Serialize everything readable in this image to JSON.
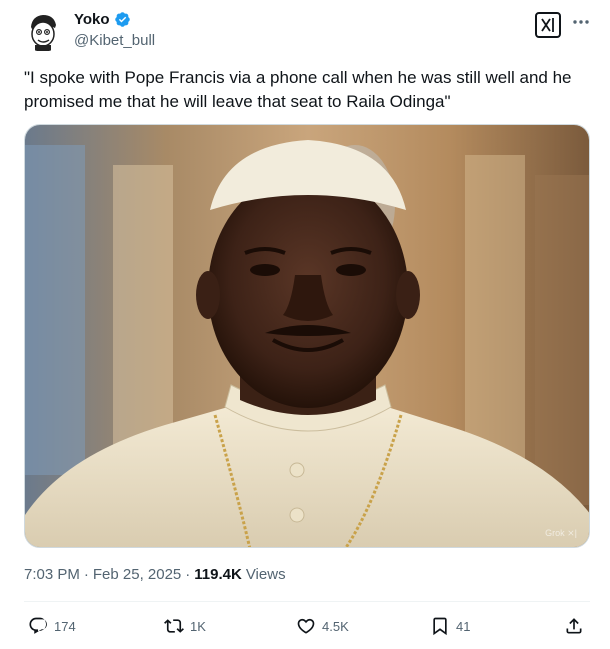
{
  "author": {
    "display_name": "Yoko",
    "handle": "@Kibet_bull",
    "verified": true,
    "avatar_icon": "cartoon-avatar"
  },
  "header": {
    "grok_icon": "grok-icon",
    "more_icon": "more-options-icon"
  },
  "tweet": {
    "text": "\"I spoke with Pope Francis via a phone call  when he was still well and he promised me that he will leave that seat to Raila Odinga\""
  },
  "media": {
    "watermark": "Grok ⨯|"
  },
  "meta": {
    "time": "7:03 PM",
    "separator": "·",
    "date": "Feb 25, 2025",
    "separator2": "·",
    "views_count": "119.4K",
    "views_label": "Views"
  },
  "actions": {
    "replies": "174",
    "reposts": "1K",
    "likes": "4.5K",
    "bookmarks": "41"
  },
  "colors": {
    "text": "#0f1419",
    "secondary": "#536471",
    "verified_blue": "#1d9bf0",
    "divider": "#eff3f4"
  }
}
